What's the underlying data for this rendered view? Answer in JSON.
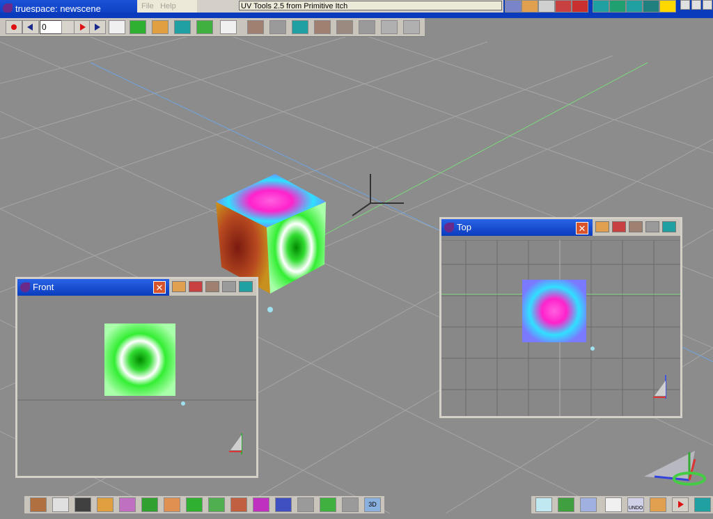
{
  "app": {
    "title": "truespace: newscene"
  },
  "menu": {
    "file": "File",
    "help": "Help"
  },
  "plugin": {
    "title": "UV Tools 2.5  from Primitive Itch"
  },
  "toolbar": {
    "frame_value": "0"
  },
  "windows": {
    "front": {
      "title": "Front"
    },
    "top": {
      "title": "Top"
    }
  },
  "bottom": {
    "undo_label": "UNDO",
    "threed_label": "3D"
  },
  "colors": {
    "titlebar": "#0a3bbd",
    "viewport": "#8c8c8c",
    "grid": "#a8a8a8",
    "accent_green": "#33dd33",
    "accent_magenta": "#ff22cc"
  }
}
